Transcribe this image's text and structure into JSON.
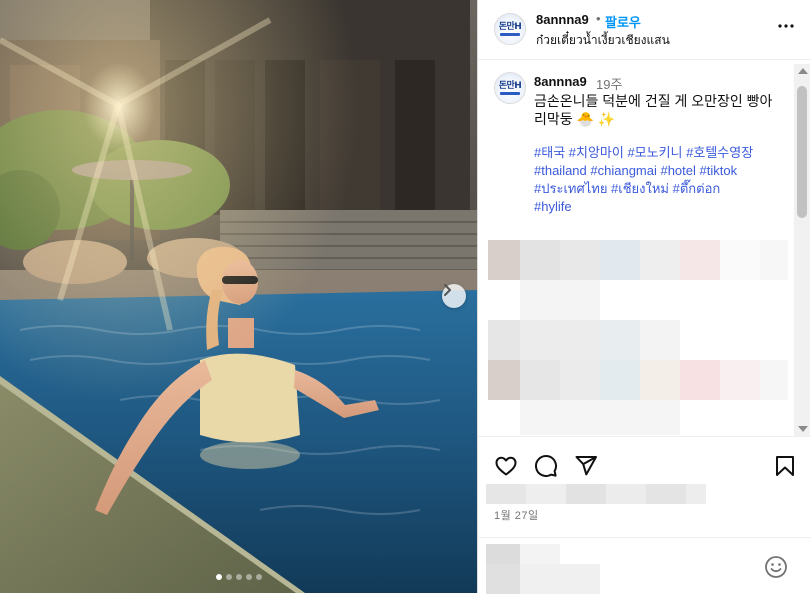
{
  "post": {
    "username": "8annna9",
    "separator": "•",
    "follow_label": "팔로우",
    "location": "ก๋วยเตี๋ยวน้ำเงี้ยวเชียงแสน",
    "avatar_text": "돈만H",
    "caption": {
      "username": "8annna9",
      "time": "19주",
      "text": "금손온니들 덕분에 건질 게 오만장인 빵아리막둥 🐣 ✨",
      "hashtags_line1": "#태국 #치앙마이 #모노키니 #호텔수영장",
      "hashtags_line2": "#thailand #chiangmai #hotel #tiktok",
      "hashtags_line3": "#ประเทศไทย #เชียงใหม่ #ตึ๊กต่อก",
      "hashtags_line4": "#hylife"
    },
    "date": "1월 27일",
    "carousel": {
      "slide_count": 5,
      "active_index": 0
    }
  },
  "icons": {
    "more": "more-options-icon",
    "like": "heart-icon",
    "comment": "comment-bubble-icon",
    "share": "paper-plane-icon",
    "save": "bookmark-icon",
    "emoji": "smiley-icon",
    "next": "chevron-right-icon"
  },
  "colors": {
    "follow": "#0095f6",
    "hashtag": "#3b5adb",
    "muted": "#737373",
    "pool": "#1f5f8f"
  }
}
